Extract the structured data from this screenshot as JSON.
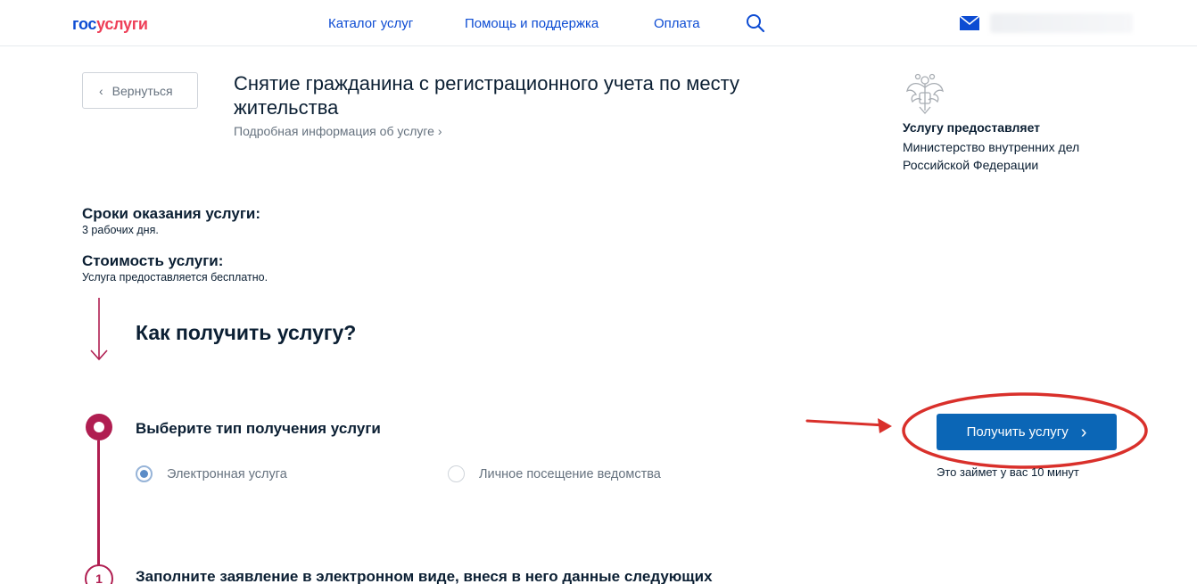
{
  "header": {
    "logo_part1": "гос",
    "logo_part2": "услуги",
    "nav": [
      "Каталог услуг",
      "Помощь и поддержка",
      "Оплата"
    ]
  },
  "back_button": {
    "label": "Вернуться"
  },
  "service": {
    "title": "Снятие гражданина с регистрационного учета по месту жительства",
    "info_link": "Подробная информация об услуге"
  },
  "provider": {
    "label": "Услугу предоставляет",
    "name": "Министерство внутренних дел Российской Федерации"
  },
  "terms": {
    "label": "Сроки оказания услуги:",
    "value": "3 рабочих дня."
  },
  "cost": {
    "label": "Стоимость услуги:",
    "value": "Услуга предоставляется бесплатно."
  },
  "how": {
    "title": "Как получить услугу?",
    "step1": {
      "title": "Выберите тип получения услуги",
      "options": [
        {
          "label": "Электронная услуга",
          "checked": true
        },
        {
          "label": "Личное посещение ведомства",
          "checked": false
        }
      ]
    },
    "step2": {
      "number": "1",
      "title": "Заполните заявление в электронном виде, внеся в него данные следующих"
    }
  },
  "action": {
    "button_label": "Получить услугу",
    "time_note": "Это займет у вас 10 минут"
  },
  "colors": {
    "primary_blue": "#0d4cd3",
    "button_blue": "#0b66b6",
    "accent_crimson": "#b01e51",
    "annotation_red": "#d9302b"
  },
  "icons": [
    "search-icon",
    "mail-icon",
    "emblem-icon",
    "chevron-left-icon",
    "chevron-right-icon",
    "arrow-down-icon"
  ]
}
